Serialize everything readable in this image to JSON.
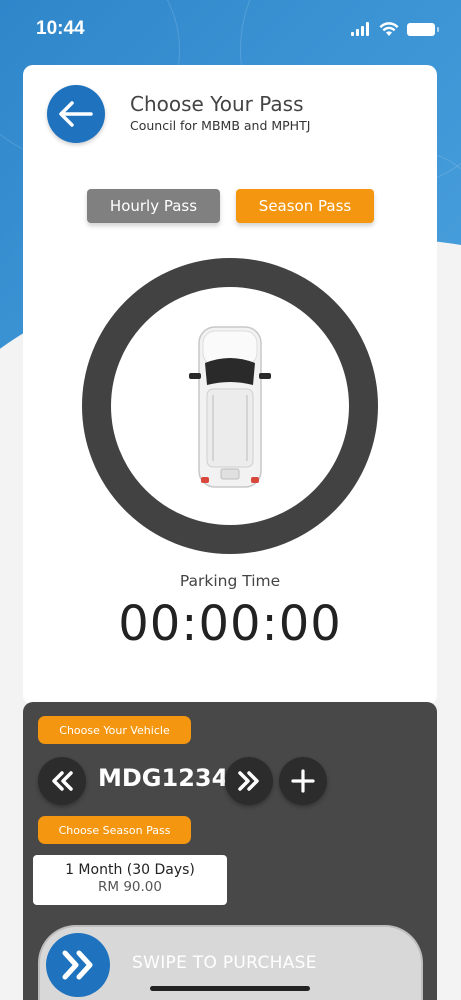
{
  "status_bar": {
    "time": "10:44"
  },
  "header": {
    "title": "Choose Your Pass",
    "subtitle": "Council for MBMB and MPHTJ"
  },
  "pass_tabs": {
    "hourly_label": "Hourly Pass",
    "season_label": "Season Pass",
    "selected": "Season Pass"
  },
  "parking": {
    "label": "Parking Time",
    "value": "00:00:00"
  },
  "vehicle": {
    "tag": "Choose Your Vehicle",
    "plate": "MDG1234"
  },
  "season": {
    "tag": "Choose Season Pass",
    "duration": "1 Month (30 Days)",
    "price": "RM 90.00"
  },
  "swipe": {
    "label": "SWIPE TO PURCHASE"
  },
  "colors": {
    "primary_blue": "#1f72bd",
    "accent_orange": "#f4960f",
    "panel_dark": "#484848",
    "ring": "#424242"
  }
}
